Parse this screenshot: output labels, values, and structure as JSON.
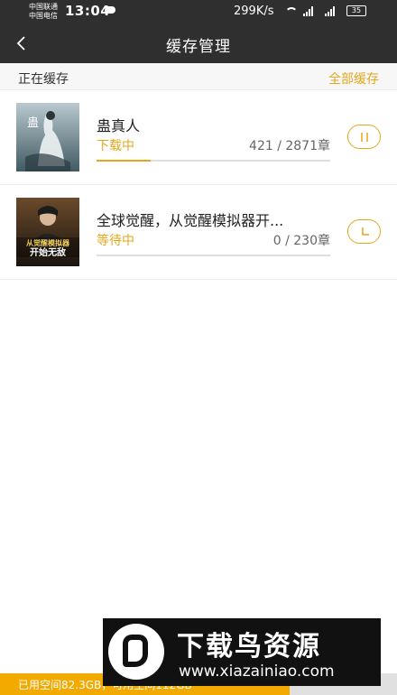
{
  "status_bar": {
    "carrier1": "中国联通",
    "carrier2": "中国电信",
    "time": "13:04",
    "speed": "299K/s",
    "battery": "35"
  },
  "header": {
    "title": "缓存管理"
  },
  "section": {
    "label": "正在缓存",
    "download_all": "全部缓存"
  },
  "items": [
    {
      "title": "蛊真人",
      "status": "下载中",
      "progress": "421 / 2871章",
      "progress_fraction": 0.23,
      "action_icon": "pause-icon",
      "cover_text": "蛊"
    },
    {
      "title": "全球觉醒，从觉醒模拟器开...",
      "status": "等待中",
      "progress": "0 / 230章",
      "progress_fraction": 0,
      "action_icon": "clock-icon",
      "cover_text": "从觉醒模拟器 开始无敌"
    }
  ],
  "storage": {
    "text": "已用空间82.3GB，可用空间112GB",
    "used_fraction": 0.73
  },
  "watermark": {
    "title": "下载鸟资源",
    "url": "www.xiazainiao.com"
  },
  "colors": {
    "accent": "#e3a71b",
    "dark_bar": "#2f2f2f",
    "storage_fill": "#f2a900"
  }
}
